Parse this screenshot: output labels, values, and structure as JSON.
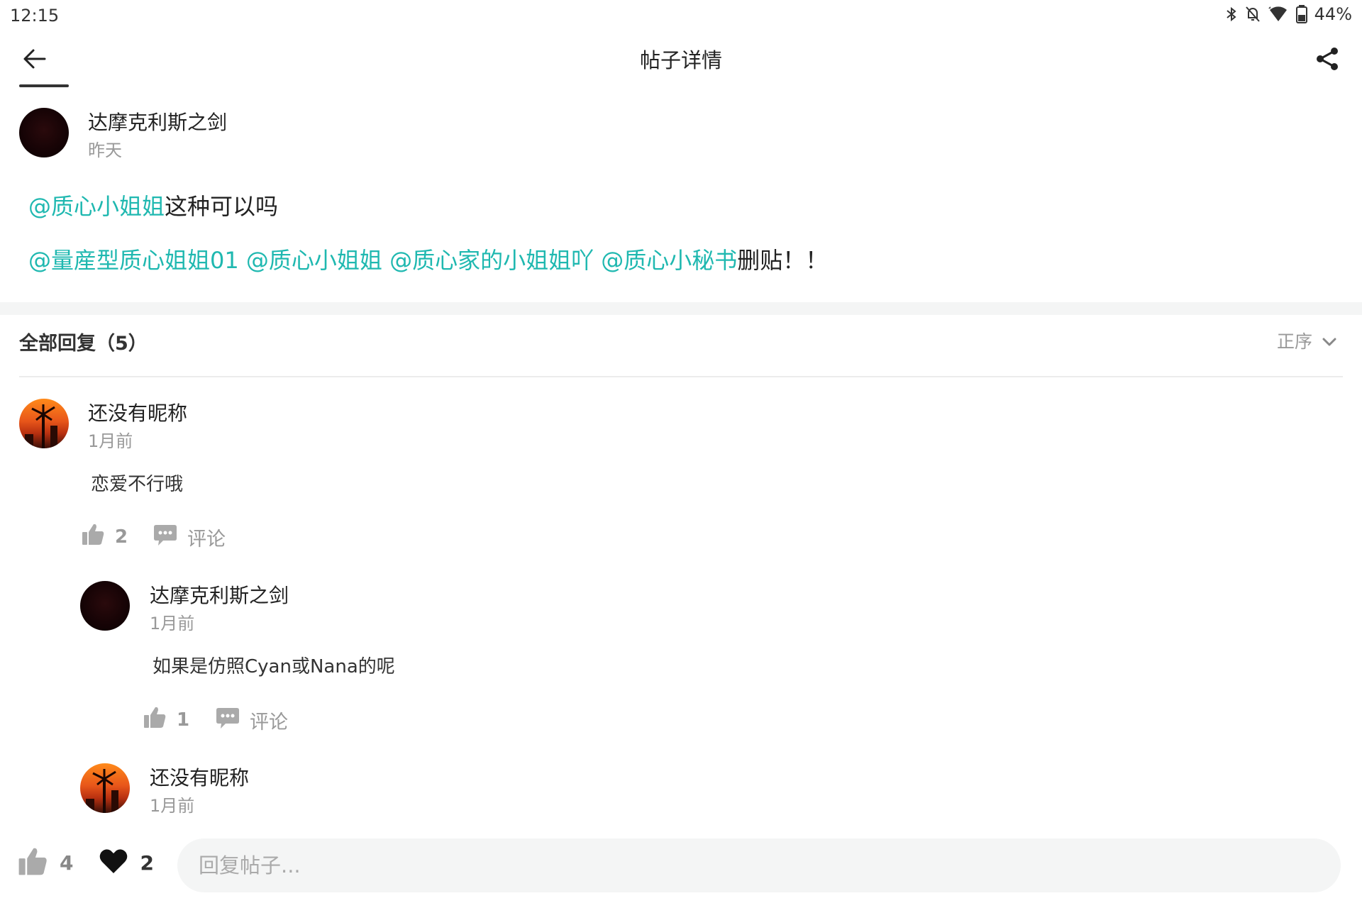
{
  "status_bar": {
    "time": "12:15",
    "battery": "44%",
    "icons": [
      "bluetooth-icon",
      "notifications-off-icon",
      "wifi-icon",
      "battery-icon"
    ]
  },
  "header": {
    "title": "帖子详情",
    "back_icon": "arrow-left-icon",
    "share_icon": "share-icon"
  },
  "post": {
    "author": "达摩克利斯之剑",
    "time": "昨天",
    "line1": {
      "mention": "@质心小姐姐",
      "text": "这种可以吗"
    },
    "line2": {
      "mention1": "@量産型质心姐姐01",
      "mention2": "@质心小姐姐",
      "mention3": "@质心家的小姐姐吖",
      "mention4": "@质心小秘书",
      "text": "删贴！！"
    }
  },
  "replies": {
    "title": "全部回复（5）",
    "sort_label": "正序",
    "items": [
      {
        "author": "还没有昵称",
        "time": "1月前",
        "text": "恋爱不行哦",
        "likes": "2",
        "comment_label": "评论"
      },
      {
        "author": "达摩克利斯之剑",
        "time": "1月前",
        "text": "如果是仿照Cyan或Nana的呢",
        "likes": "1",
        "comment_label": "评论"
      },
      {
        "author": "还没有昵称",
        "time": "1月前"
      }
    ]
  },
  "bottom_bar": {
    "likes": "4",
    "favorites": "2",
    "reply_placeholder": "回复帖子..."
  },
  "colors": {
    "mention": "#1fb8b0",
    "muted": "#999999",
    "divider": "#ececec",
    "section_gap": "#f4f5f5"
  }
}
